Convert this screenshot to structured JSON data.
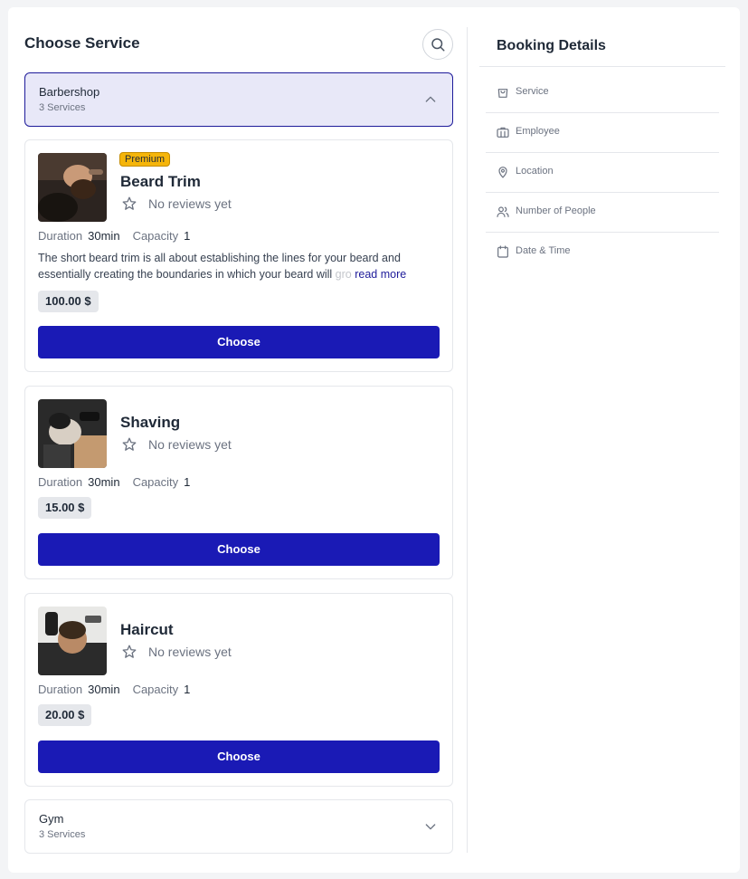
{
  "left_panel": {
    "title": "Choose Service"
  },
  "categories": [
    {
      "name": "Barbershop",
      "count": "3 Services",
      "expanded": true
    },
    {
      "name": "Gym",
      "count": "3 Services",
      "expanded": false
    }
  ],
  "services": [
    {
      "badge": "Premium",
      "name": "Beard Trim",
      "reviews": "No reviews yet",
      "duration_label": "Duration",
      "duration": "30min",
      "capacity_label": "Capacity",
      "capacity": "1",
      "description": "The short beard trim is all about establishing the lines for your beard and essentially creating the boundaries in which your beard will",
      "description_faded": "gro",
      "read_more": "read more",
      "price": "100.00 $",
      "button": "Choose"
    },
    {
      "name": "Shaving",
      "reviews": "No reviews yet",
      "duration_label": "Duration",
      "duration": "30min",
      "capacity_label": "Capacity",
      "capacity": "1",
      "price": "15.00 $",
      "button": "Choose"
    },
    {
      "name": "Haircut",
      "reviews": "No reviews yet",
      "duration_label": "Duration",
      "duration": "30min",
      "capacity_label": "Capacity",
      "capacity": "1",
      "price": "20.00 $",
      "button": "Choose"
    }
  ],
  "booking_details": {
    "title": "Booking Details",
    "items": [
      {
        "label": "Service",
        "icon": "shopping-bag-icon"
      },
      {
        "label": "Employee",
        "icon": "briefcase-icon"
      },
      {
        "label": "Location",
        "icon": "map-pin-icon"
      },
      {
        "label": "Number of People",
        "icon": "users-icon"
      },
      {
        "label": "Date & Time",
        "icon": "calendar-icon"
      }
    ]
  },
  "colors": {
    "primary": "#1a1ab5",
    "selected_category_bg": "#e8e8f8",
    "premium_badge": "#f5b50a"
  }
}
